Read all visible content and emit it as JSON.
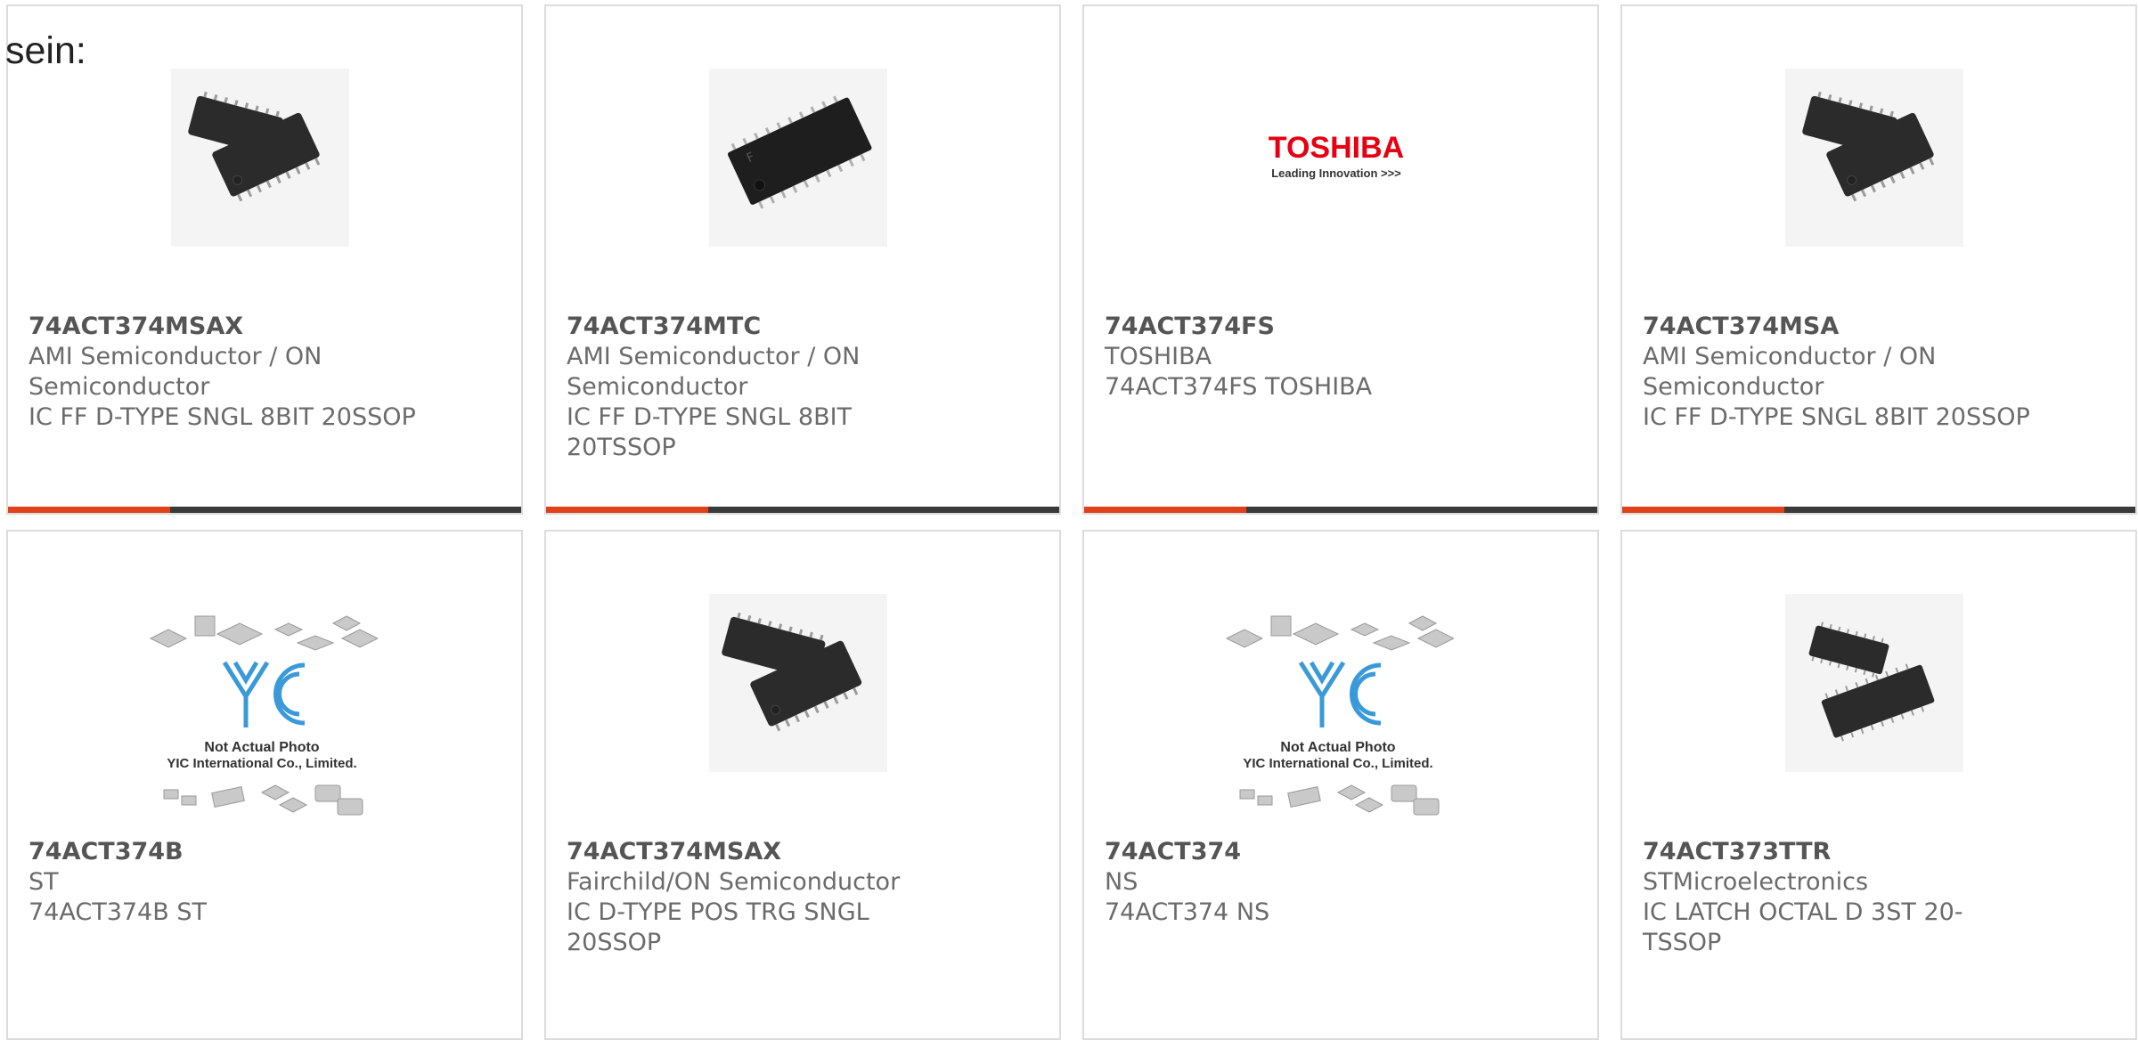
{
  "intro_text": "sein:",
  "products": [
    {
      "part": "74ACT374MSAX",
      "maker": "AMI Semiconductor / ON Semiconductor",
      "desc": "IC FF D-TYPE SNGL 8BIT 20SSOP",
      "image": "ssop-chip"
    },
    {
      "part": "74ACT374MTC",
      "maker": "AMI Semiconductor / ON Semiconductor",
      "desc": "IC FF D-TYPE SNGL 8BIT 20TSSOP",
      "image": "tssop-chip"
    },
    {
      "part": "74ACT374FS",
      "maker": "TOSHIBA",
      "desc": "74ACT374FS TOSHIBA",
      "image": "toshiba-logo",
      "logo_text": "TOSHIBA",
      "logo_tagline": "Leading Innovation >>>"
    },
    {
      "part": "74ACT374MSA",
      "maker": "AMI Semiconductor / ON Semiconductor",
      "desc": "IC FF D-TYPE SNGL 8BIT 20SSOP",
      "image": "ssop-chip"
    },
    {
      "part": "74ACT374B",
      "maker": "ST",
      "desc": "74ACT374B ST",
      "image": "yic-placeholder",
      "caption1": "Not Actual Photo",
      "caption2": "YIC International Co., Limited."
    },
    {
      "part": "74ACT374MSAX",
      "maker": "Fairchild/ON Semiconductor",
      "desc": "IC D-TYPE POS TRG SNGL 20SSOP",
      "image": "ssop-chip"
    },
    {
      "part": "74ACT374",
      "maker": "NS",
      "desc": "74ACT374 NS",
      "image": "yic-placeholder",
      "caption1": "Not Actual Photo",
      "caption2": "YIC International Co., Limited."
    },
    {
      "part": "74ACT373TTR",
      "maker": "STMicroelectronics",
      "desc": "IC LATCH OCTAL D 3ST 20-TSSOP",
      "image": "tssop-pair"
    }
  ],
  "colors": {
    "accent": "#e0401a",
    "bar": "#3a3a3a",
    "border": "#dcdcdc",
    "text": "#6b6b6b",
    "toshiba_red": "#e60012"
  }
}
